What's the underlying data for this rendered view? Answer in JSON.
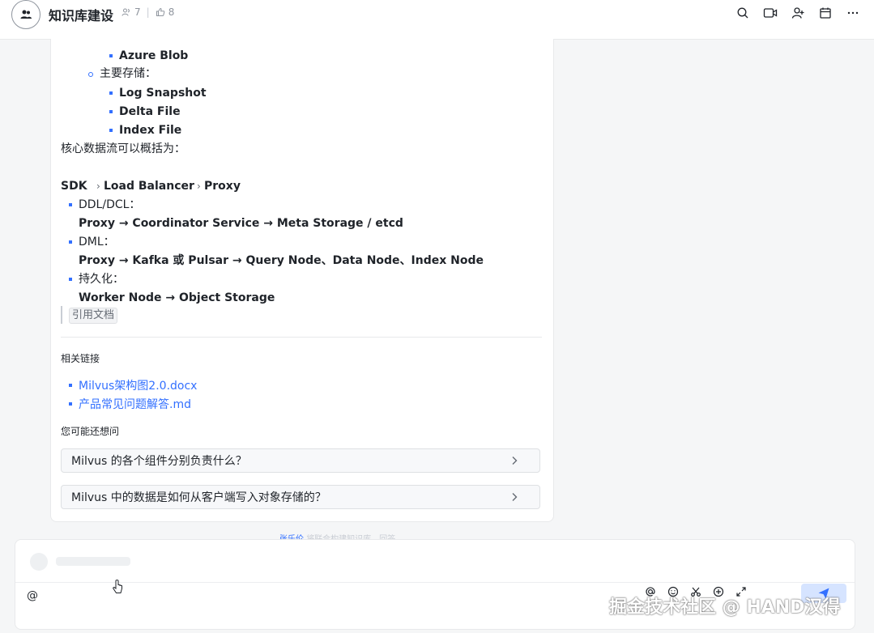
{
  "header": {
    "title": "知识库建设",
    "members_count": "7",
    "likes_count": "8"
  },
  "content": {
    "blob_item": "Azure Blob",
    "storage_label": "主要存储：",
    "storage_items": [
      "Log Snapshot",
      "Delta File",
      "Index File"
    ],
    "flow_intro": "核心数据流可以概括为：",
    "flow_sdk": "SDK",
    "flow_lb": "Load Balancer",
    "flow_proxy": "Proxy",
    "flow_arrow": "›",
    "ddl_label": "DDL/DCL：",
    "ddl_path": "Proxy → Coordinator Service → Meta Storage / etcd",
    "dml_label": "DML：",
    "dml_path": "Proxy → Kafka 或 Pulsar → Query Node、Data Node、Index Node",
    "persist_label": "持久化：",
    "persist_path": "Worker Node → Object Storage",
    "cite_button": "引用文档"
  },
  "related": {
    "title": "相关链接",
    "links": [
      "Milvus架构图2.0.docx",
      "产品常见问题解答.md"
    ]
  },
  "suggestions": {
    "title": "您可能还想问",
    "items": [
      "Milvus 的各个组件分别负责什么？",
      "Milvus 中的数据是如何从客户端写入对象存储的？"
    ]
  },
  "disclaimer": {
    "highlight": "张乐伦",
    "text": "将联合构建知识库，回答"
  },
  "composer": {
    "value": "@"
  },
  "watermark": "掘金技术社区 @ HAND汉得",
  "colors": {
    "accent": "#3370ff",
    "text": "#1f2329",
    "border": "#dee0e3"
  }
}
